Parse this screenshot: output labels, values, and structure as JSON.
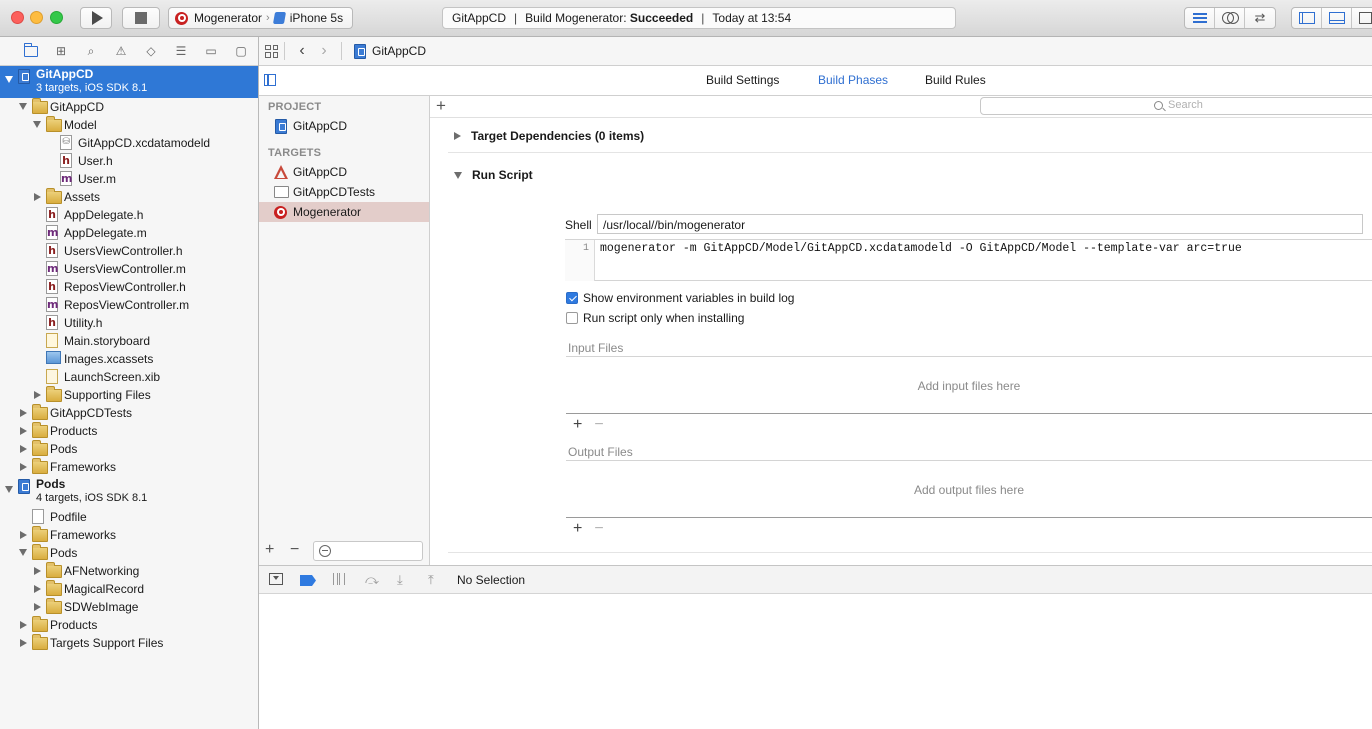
{
  "toolbar": {
    "scheme_target": "Mogenerator",
    "scheme_device": "iPhone 5s",
    "activity_project": "GitAppCD",
    "activity_status_prefix": "Build Mogenerator:",
    "activity_status_result": "Succeeded",
    "activity_time": "Today at 13:54"
  },
  "navigator": {
    "tabs": [
      "folder-icon",
      "symbol-icon",
      "search-icon",
      "issue-icon",
      "test-icon",
      "debug-icon",
      "breakpoint-icon",
      "report-icon"
    ],
    "tree": [
      {
        "label": "GitAppCD",
        "sub": "3 targets, iOS SDK 8.1",
        "icon": "project",
        "level": 0,
        "open": true,
        "selected": true
      },
      {
        "label": "GitAppCD",
        "icon": "folder",
        "level": 1,
        "open": true
      },
      {
        "label": "Model",
        "icon": "folder",
        "level": 2,
        "open": true
      },
      {
        "label": "GitAppCD.xcdatamodeld",
        "icon": "model",
        "level": 3
      },
      {
        "label": "User.h",
        "icon": "h",
        "level": 3
      },
      {
        "label": "User.m",
        "icon": "m",
        "level": 3
      },
      {
        "label": "Assets",
        "icon": "folder",
        "level": 2,
        "open": false
      },
      {
        "label": "AppDelegate.h",
        "icon": "h",
        "level": 2
      },
      {
        "label": "AppDelegate.m",
        "icon": "m",
        "level": 2
      },
      {
        "label": "UsersViewController.h",
        "icon": "h",
        "level": 2
      },
      {
        "label": "UsersViewController.m",
        "icon": "m",
        "level": 2
      },
      {
        "label": "ReposViewController.h",
        "icon": "h",
        "level": 2
      },
      {
        "label": "ReposViewController.m",
        "icon": "m",
        "level": 2
      },
      {
        "label": "Utility.h",
        "icon": "h",
        "level": 2
      },
      {
        "label": "Main.storyboard",
        "icon": "sb",
        "level": 2
      },
      {
        "label": "Images.xcassets",
        "icon": "xcassets",
        "level": 2
      },
      {
        "label": "LaunchScreen.xib",
        "icon": "xib",
        "level": 2
      },
      {
        "label": "Supporting Files",
        "icon": "folder",
        "level": 2,
        "open": false
      },
      {
        "label": "GitAppCDTests",
        "icon": "folder",
        "level": 1,
        "open": false
      },
      {
        "label": "Products",
        "icon": "folder",
        "level": 1,
        "open": false
      },
      {
        "label": "Pods",
        "icon": "folder",
        "level": 1,
        "open": false
      },
      {
        "label": "Frameworks",
        "icon": "folder",
        "level": 1,
        "open": false
      },
      {
        "label": "Pods",
        "sub": "4 targets, iOS SDK 8.1",
        "icon": "project",
        "level": 0,
        "open": true
      },
      {
        "label": "Podfile",
        "icon": "plain",
        "level": 1
      },
      {
        "label": "Frameworks",
        "icon": "folder",
        "level": 1,
        "open": false
      },
      {
        "label": "Pods",
        "icon": "folder",
        "level": 1,
        "open": true
      },
      {
        "label": "AFNetworking",
        "icon": "folder",
        "level": 2,
        "open": false
      },
      {
        "label": "MagicalRecord",
        "icon": "folder",
        "level": 2,
        "open": false
      },
      {
        "label": "SDWebImage",
        "icon": "folder",
        "level": 2,
        "open": false
      },
      {
        "label": "Products",
        "icon": "folder",
        "level": 1,
        "open": false
      },
      {
        "label": "Targets Support Files",
        "icon": "folder",
        "level": 1,
        "open": false
      }
    ]
  },
  "jumpbar": {
    "project": "GitAppCD"
  },
  "editor_tabs": {
    "build_settings": "Build Settings",
    "build_phases": "Build Phases",
    "build_rules": "Build Rules"
  },
  "targets_pane": {
    "project_header": "PROJECT",
    "project_name": "GitAppCD",
    "targets_header": "TARGETS",
    "targets": [
      {
        "label": "GitAppCD",
        "icon": "app"
      },
      {
        "label": "GitAppCDTests",
        "icon": "bundle"
      },
      {
        "label": "Mogenerator",
        "icon": "target",
        "selected": true
      }
    ]
  },
  "phases": {
    "search_placeholder": "Search",
    "target_dependencies": "Target Dependencies (0 items)",
    "run_script": "Run Script",
    "shell_label": "Shell",
    "shell_value": "/usr/local//bin/mogenerator",
    "script_line_number": "1",
    "script_line": "mogenerator -m GitAppCD/Model/GitAppCD.xcdatamodeld -O GitAppCD/Model --template-var arc=true",
    "show_env_label": "Show environment variables in build log",
    "show_env_checked": true,
    "run_only_installing_label": "Run script only when installing",
    "run_only_installing_checked": false,
    "input_files_header": "Input Files",
    "input_files_placeholder": "Add input files here",
    "output_files_header": "Output Files",
    "output_files_placeholder": "Add output files here"
  },
  "debug_bar": {
    "selection": "No Selection"
  },
  "colors": {
    "accent": "#2f78d6",
    "selected_target_bg": "#e3cdca"
  }
}
